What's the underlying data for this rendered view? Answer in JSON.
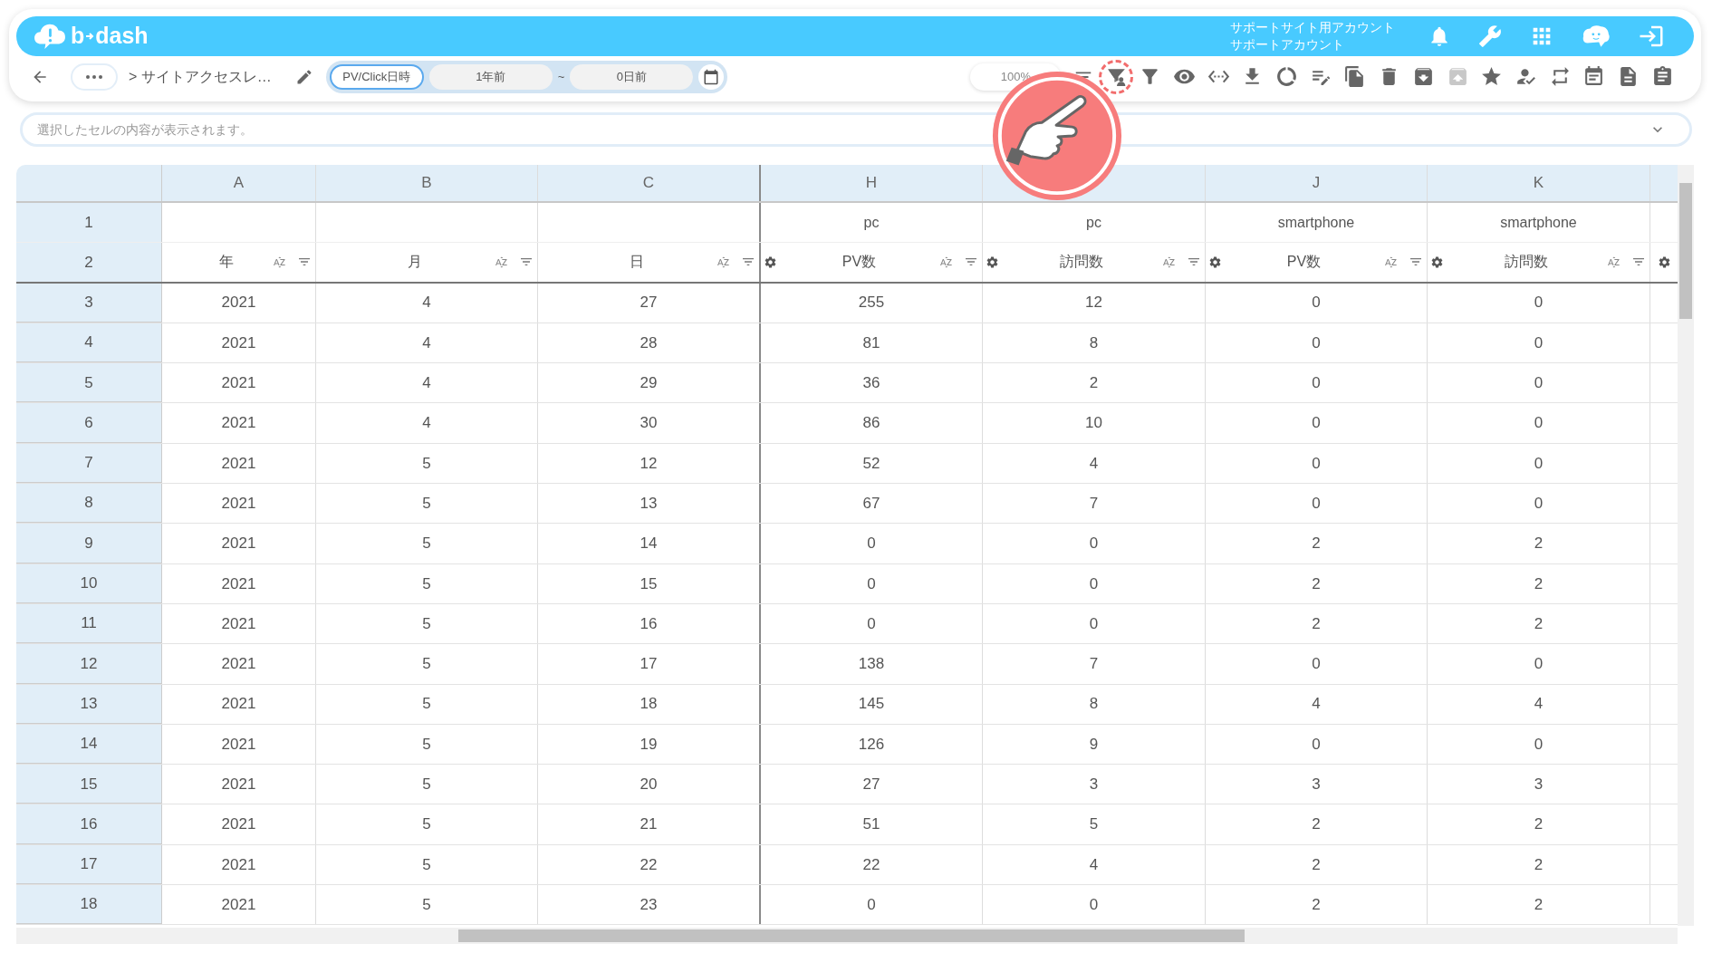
{
  "header": {
    "logo": {
      "left": "b",
      "right": "dash"
    },
    "account": [
      "サポートサイト用アカウント",
      "サポートアカウント"
    ]
  },
  "toolbar": {
    "breadcrumb": "> サイトアクセスレ…",
    "date_range": {
      "type_button": {
        "label": "PV/Click日時",
        "active": true
      },
      "from": "1年前",
      "separator": "~",
      "to": "0日前"
    },
    "zoom": "100%",
    "tools": [
      {
        "kind": "filter-user",
        "highlighted": true,
        "disabled": false
      },
      {
        "kind": "filter",
        "highlighted": false,
        "disabled": false
      },
      {
        "kind": "eye",
        "highlighted": false,
        "disabled": false
      },
      {
        "kind": "code",
        "highlighted": false,
        "disabled": false
      },
      {
        "kind": "download",
        "highlighted": false,
        "disabled": false
      },
      {
        "kind": "chart",
        "highlighted": false,
        "disabled": false
      },
      {
        "kind": "edit",
        "highlighted": false,
        "disabled": false
      },
      {
        "kind": "copy",
        "highlighted": false,
        "disabled": false
      },
      {
        "kind": "trash",
        "highlighted": false,
        "disabled": false
      },
      {
        "kind": "archive",
        "highlighted": false,
        "disabled": false
      },
      {
        "kind": "unarchive",
        "highlighted": false,
        "disabled": true
      },
      {
        "kind": "star",
        "highlighted": false,
        "disabled": false
      },
      {
        "kind": "user-check",
        "highlighted": false,
        "disabled": false
      },
      {
        "kind": "repeat",
        "highlighted": false,
        "disabled": false
      },
      {
        "kind": "calendar",
        "highlighted": false,
        "disabled": false
      },
      {
        "kind": "file",
        "highlighted": false,
        "disabled": false
      },
      {
        "kind": "clipboard",
        "highlighted": false,
        "disabled": false
      }
    ]
  },
  "cell_field": {
    "placeholder": "選択したセルの内容が表示されます。"
  },
  "table": {
    "columns": [
      {
        "letter": "A",
        "row2": "年",
        "gear": false
      },
      {
        "letter": "B",
        "row2": "月",
        "gear": false
      },
      {
        "letter": "C",
        "row2": "日",
        "gear": false
      },
      {
        "letter": "H",
        "row1": "pc",
        "row2": "PV数",
        "gear": true
      },
      {
        "row1": "pc",
        "row2": "訪問数",
        "gear": true
      },
      {
        "letter": "J",
        "row1": "smartphone",
        "row2": "PV数",
        "gear": true
      },
      {
        "letter": "K",
        "row1": "smartphone",
        "row2": "訪問数",
        "gear": true
      }
    ],
    "header_rows": [
      "1",
      "2"
    ],
    "rows": [
      {
        "num": "3",
        "cells": [
          "2021",
          "4",
          "27",
          "255",
          "12",
          "0",
          "0"
        ]
      },
      {
        "num": "4",
        "cells": [
          "2021",
          "4",
          "28",
          "81",
          "8",
          "0",
          "0"
        ]
      },
      {
        "num": "5",
        "cells": [
          "2021",
          "4",
          "29",
          "36",
          "2",
          "0",
          "0"
        ]
      },
      {
        "num": "6",
        "cells": [
          "2021",
          "4",
          "30",
          "86",
          "10",
          "0",
          "0"
        ]
      },
      {
        "num": "7",
        "cells": [
          "2021",
          "5",
          "12",
          "52",
          "4",
          "0",
          "0"
        ]
      },
      {
        "num": "8",
        "cells": [
          "2021",
          "5",
          "13",
          "67",
          "7",
          "0",
          "0"
        ]
      },
      {
        "num": "9",
        "cells": [
          "2021",
          "5",
          "14",
          "0",
          "0",
          "2",
          "2"
        ]
      },
      {
        "num": "10",
        "cells": [
          "2021",
          "5",
          "15",
          "0",
          "0",
          "2",
          "2"
        ]
      },
      {
        "num": "11",
        "cells": [
          "2021",
          "5",
          "16",
          "0",
          "0",
          "2",
          "2"
        ]
      },
      {
        "num": "12",
        "cells": [
          "2021",
          "5",
          "17",
          "138",
          "7",
          "0",
          "0"
        ]
      },
      {
        "num": "13",
        "cells": [
          "2021",
          "5",
          "18",
          "145",
          "8",
          "4",
          "4"
        ]
      },
      {
        "num": "14",
        "cells": [
          "2021",
          "5",
          "19",
          "126",
          "9",
          "0",
          "0"
        ]
      },
      {
        "num": "15",
        "cells": [
          "2021",
          "5",
          "20",
          "27",
          "3",
          "3",
          "3"
        ]
      },
      {
        "num": "16",
        "cells": [
          "2021",
          "5",
          "21",
          "51",
          "5",
          "2",
          "2"
        ]
      },
      {
        "num": "17",
        "cells": [
          "2021",
          "5",
          "22",
          "22",
          "4",
          "2",
          "2"
        ]
      },
      {
        "num": "18",
        "cells": [
          "2021",
          "5",
          "23",
          "0",
          "0",
          "2",
          "2"
        ]
      }
    ],
    "next_column_gear": true
  },
  "tutorial_pointer": {
    "shown": true
  }
}
